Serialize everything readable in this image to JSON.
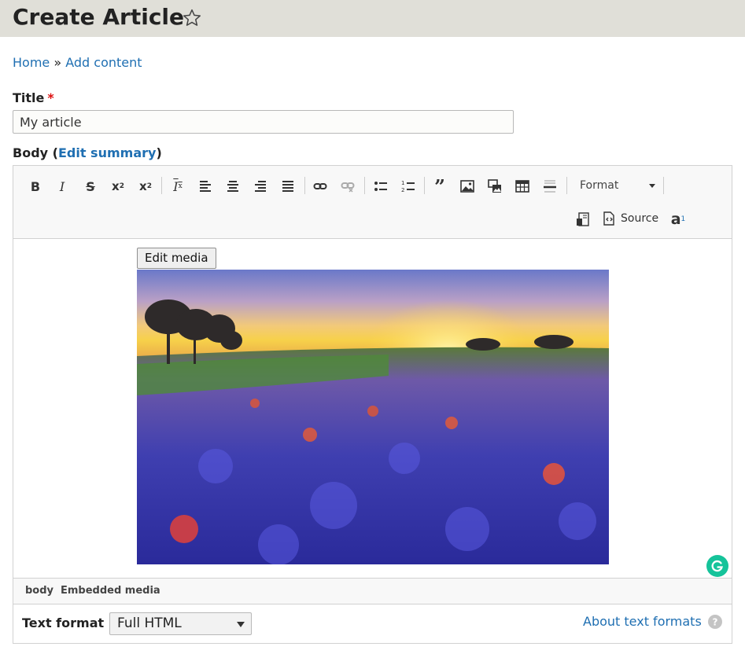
{
  "page": {
    "title": "Create Article"
  },
  "breadcrumb": {
    "home": "Home",
    "separator": "»",
    "current": "Add content"
  },
  "title_field": {
    "label": "Title",
    "required_mark": "*",
    "value": "My article"
  },
  "body_field": {
    "label": "Body",
    "open_paren": "(",
    "summary_link": "Edit summary",
    "close_paren": ")"
  },
  "toolbar": {
    "format_label": "Format",
    "source_label": "Source",
    "buttons": [
      "bold-icon",
      "italic-icon",
      "strikethrough-icon",
      "superscript-icon",
      "subscript-icon",
      "remove-format-icon",
      "align-left-icon",
      "align-center-icon",
      "align-right-icon",
      "justify-icon",
      "link-icon",
      "unlink-icon",
      "bulleted-list-icon",
      "numbered-list-icon",
      "blockquote-icon",
      "image-icon",
      "media-embed-icon",
      "table-icon",
      "horizontal-rule-icon",
      "template-icon",
      "source-icon",
      "language-icon"
    ]
  },
  "editor_content": {
    "edit_media_button": "Edit media",
    "image_alt": "bluebonnet field at sunset"
  },
  "elements_path": {
    "items": [
      "body",
      "Embedded media"
    ]
  },
  "text_format": {
    "label": "Text format",
    "selected": "Full HTML",
    "about_link": "About text formats"
  },
  "colors": {
    "header_bg": "#e0dfd8",
    "link": "#1f6fb2",
    "required": "#dd1111",
    "grammarly": "#15c39a"
  }
}
